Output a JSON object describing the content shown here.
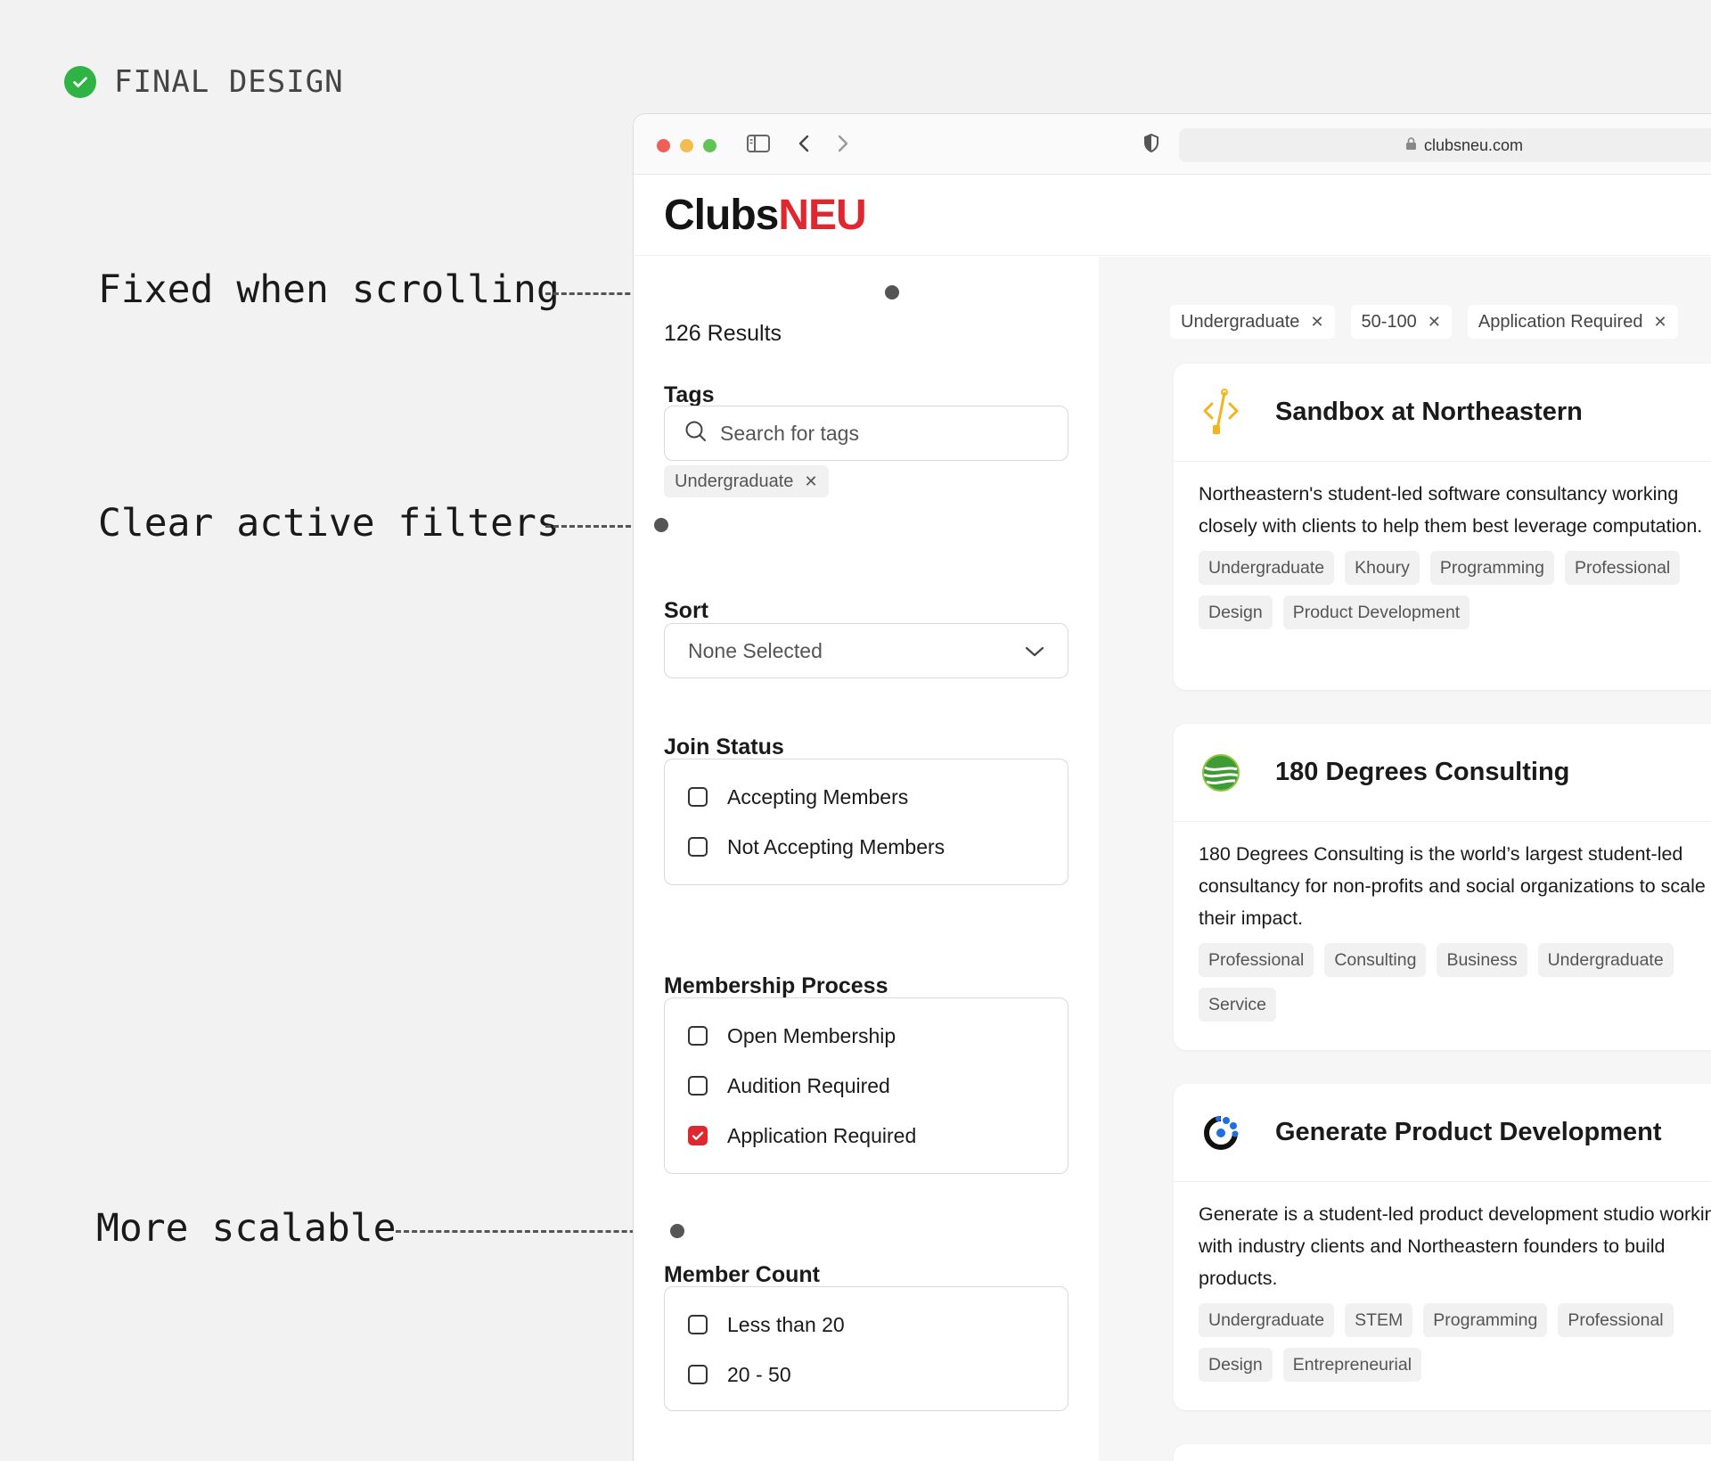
{
  "header": {
    "label": "FINAL DESIGN"
  },
  "annotations": {
    "fixed": "Fixed when scrolling",
    "clear": "Clear active filters",
    "scalable": "More scalable"
  },
  "browser": {
    "url": "clubsneu.com"
  },
  "site": {
    "logo_part1": "Clubs",
    "logo_part2": "NEU",
    "brand_color": "#e0262f"
  },
  "sidebar": {
    "results": "126 Results",
    "tags": {
      "title": "Tags",
      "placeholder": "Search for tags",
      "active": "Undergraduate"
    },
    "sort": {
      "title": "Sort",
      "value": "None Selected"
    },
    "join_status": {
      "title": "Join Status",
      "options": [
        "Accepting Members",
        "Not Accepting Members"
      ]
    },
    "membership": {
      "title": "Membership Process",
      "options": [
        "Open Membership",
        "Audition Required",
        "Application Required"
      ]
    },
    "member_count": {
      "title": "Member Count",
      "options": [
        "Less than 20",
        "20 - 50"
      ]
    }
  },
  "main": {
    "active_filters": [
      "Undergraduate",
      "50-100",
      "Application Required"
    ],
    "cards": [
      {
        "title": "Sandbox at Northeastern",
        "icon": "sandbox-logo",
        "description": "Northeastern's student-led software consultancy working closely with clients to help them best leverage computation.",
        "tags": [
          "Undergraduate",
          "Khoury",
          "Programming",
          "Professional",
          "Design",
          "Product Development"
        ]
      },
      {
        "title": "180 Degrees Consulting",
        "icon": "180dc-logo",
        "description": "180 Degrees Consulting is the world’s largest student-led consultancy for non-profits and social organizations to scale their impact.",
        "tags": [
          "Professional",
          "Consulting",
          "Business",
          "Undergraduate",
          "Service"
        ]
      },
      {
        "title": "Generate Product Development",
        "icon": "generate-logo",
        "description": "Generate is a student-led product development studio working with industry clients and Northeastern founders to build products.",
        "tags": [
          "Undergraduate",
          "STEM",
          "Programming",
          "Professional",
          "Design",
          "Entrepreneurial"
        ]
      }
    ]
  }
}
